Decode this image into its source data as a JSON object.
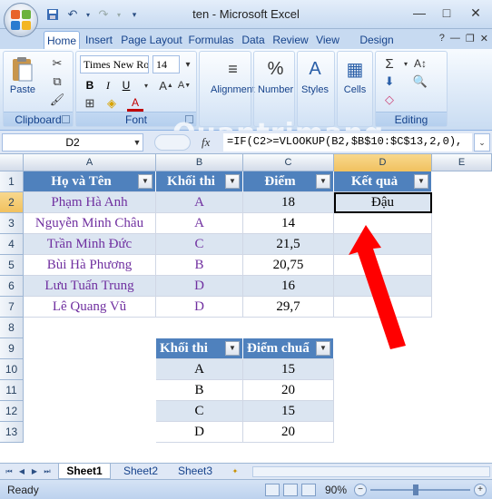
{
  "window": {
    "title": "ten - Microsoft Excel",
    "controls": {
      "minimize": "—",
      "maximize": "□",
      "close": "✕"
    }
  },
  "qat": {
    "icons": [
      "save-icon",
      "undo-icon",
      "redo-icon",
      "customize-icon"
    ]
  },
  "tabs": [
    {
      "label": "Home",
      "active": true
    },
    {
      "label": "Insert"
    },
    {
      "label": "Page Layout"
    },
    {
      "label": "Formulas"
    },
    {
      "label": "Data"
    },
    {
      "label": "Review"
    },
    {
      "label": "View"
    },
    {
      "label": "Design"
    }
  ],
  "ribbon": {
    "clipboard": {
      "label": "Clipboard",
      "paste": "Paste"
    },
    "font": {
      "label": "Font",
      "family": "Times New Ro",
      "size": "14",
      "bold": "B",
      "italic": "I",
      "underline": "U",
      "fontcolor": "A"
    },
    "alignment": {
      "label": "Alignment"
    },
    "number": {
      "label": "Number"
    },
    "styles": {
      "label": "Styles"
    },
    "cells": {
      "label": "Cells"
    },
    "editing": {
      "label": "Editing"
    },
    "watermark": "Quantrimang"
  },
  "formula_bar": {
    "name_box": "D2",
    "fx": "fx",
    "formula": "=IF(C2>=VLOOKUP(B2,$B$10:$C$13,2,0),"
  },
  "columns": [
    "A",
    "B",
    "C",
    "D",
    "E"
  ],
  "rows": [
    "1",
    "2",
    "3",
    "4",
    "5",
    "6",
    "7",
    "8",
    "9",
    "10",
    "11",
    "12",
    "13"
  ],
  "table1": {
    "headers": [
      "Họ và Tên",
      "Khối thi",
      "Điểm",
      "Kết quả"
    ],
    "rows": [
      [
        "Phạm Hà Anh",
        "A",
        "18",
        "Đậu"
      ],
      [
        "Nguyễn Minh Châu",
        "A",
        "14",
        ""
      ],
      [
        "Trần Minh Đức",
        "C",
        "21,5",
        ""
      ],
      [
        "Bùi Hà Phương",
        "B",
        "20,75",
        ""
      ],
      [
        "Lưu Tuấn Trung",
        "D",
        "16",
        ""
      ],
      [
        "Lê Quang Vũ",
        "D",
        "29,7",
        ""
      ]
    ]
  },
  "table2": {
    "headers": [
      "Khối thi",
      "Điểm chuẩ"
    ],
    "rows": [
      [
        "A",
        "15"
      ],
      [
        "B",
        "20"
      ],
      [
        "C",
        "15"
      ],
      [
        "D",
        "20"
      ]
    ]
  },
  "sheets": [
    {
      "label": "Sheet1",
      "active": true
    },
    {
      "label": "Sheet2"
    },
    {
      "label": "Sheet3"
    }
  ],
  "status": {
    "text": "Ready",
    "zoom": "90%",
    "zoom_fraction": 0.45
  },
  "colors": {
    "header": "#4f81bd",
    "band": "#dbe5f1",
    "purple": "#7030a0",
    "arrow": "#ff0000"
  }
}
